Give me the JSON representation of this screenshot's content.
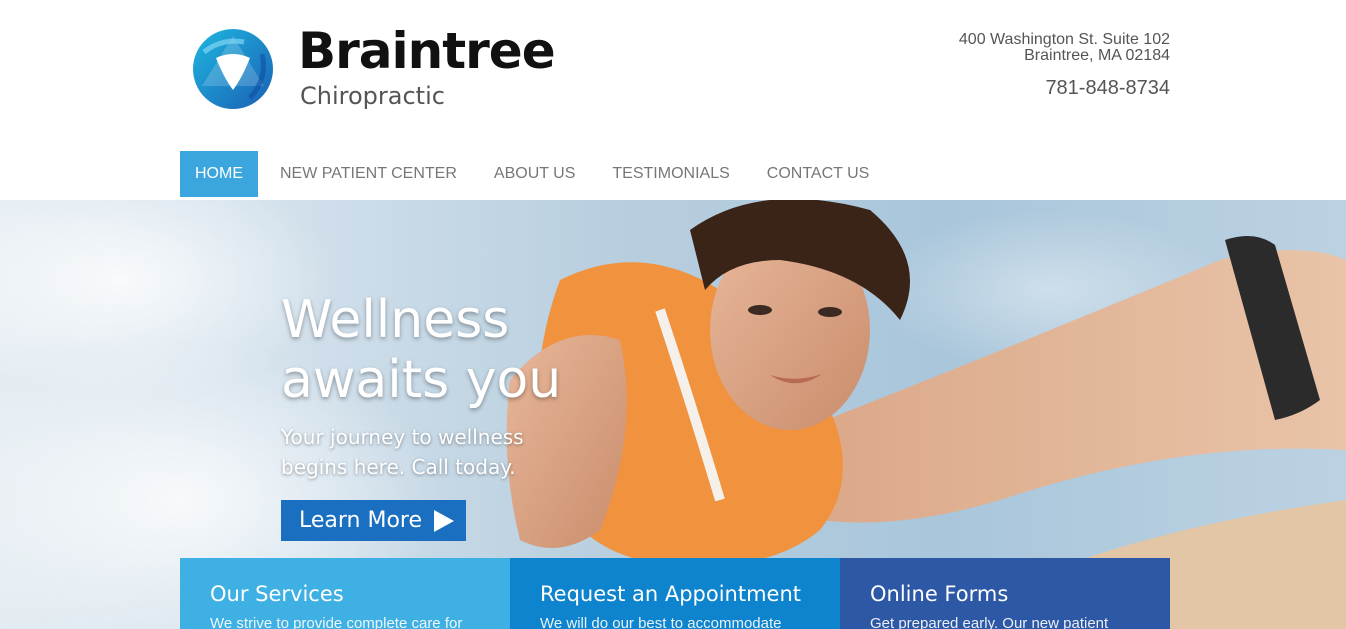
{
  "brand": {
    "name": "Braintree",
    "sub": "Chiropractic",
    "colors": {
      "primary": "#3aa6dd",
      "cta": "#1a6fc0",
      "box1": "#3fb0e4",
      "box2": "#0d84cd",
      "box3": "#2d58a5"
    }
  },
  "contact": {
    "address_line1": "400 Washington St. Suite 102",
    "address_line2": "Braintree, MA 02184",
    "phone": "781-848-8734"
  },
  "nav": {
    "items": [
      {
        "label": "HOME",
        "active": true
      },
      {
        "label": "NEW PATIENT CENTER",
        "active": false
      },
      {
        "label": "ABOUT US",
        "active": false
      },
      {
        "label": "TESTIMONIALS",
        "active": false
      },
      {
        "label": "CONTACT US",
        "active": false
      }
    ]
  },
  "hero": {
    "title_line1": "Wellness",
    "title_line2": "awaits you",
    "subtitle_line1": "Your journey to wellness",
    "subtitle_line2": "begins here. Call today.",
    "cta_label": "Learn More",
    "cta_icon": "play-arrow-icon"
  },
  "features": [
    {
      "title": "Our Services",
      "text": "We strive to provide complete care for"
    },
    {
      "title": "Request an Appointment",
      "text": "We will do our best to accommodate"
    },
    {
      "title": "Online Forms",
      "text": "Get prepared early. Our new patient"
    }
  ]
}
